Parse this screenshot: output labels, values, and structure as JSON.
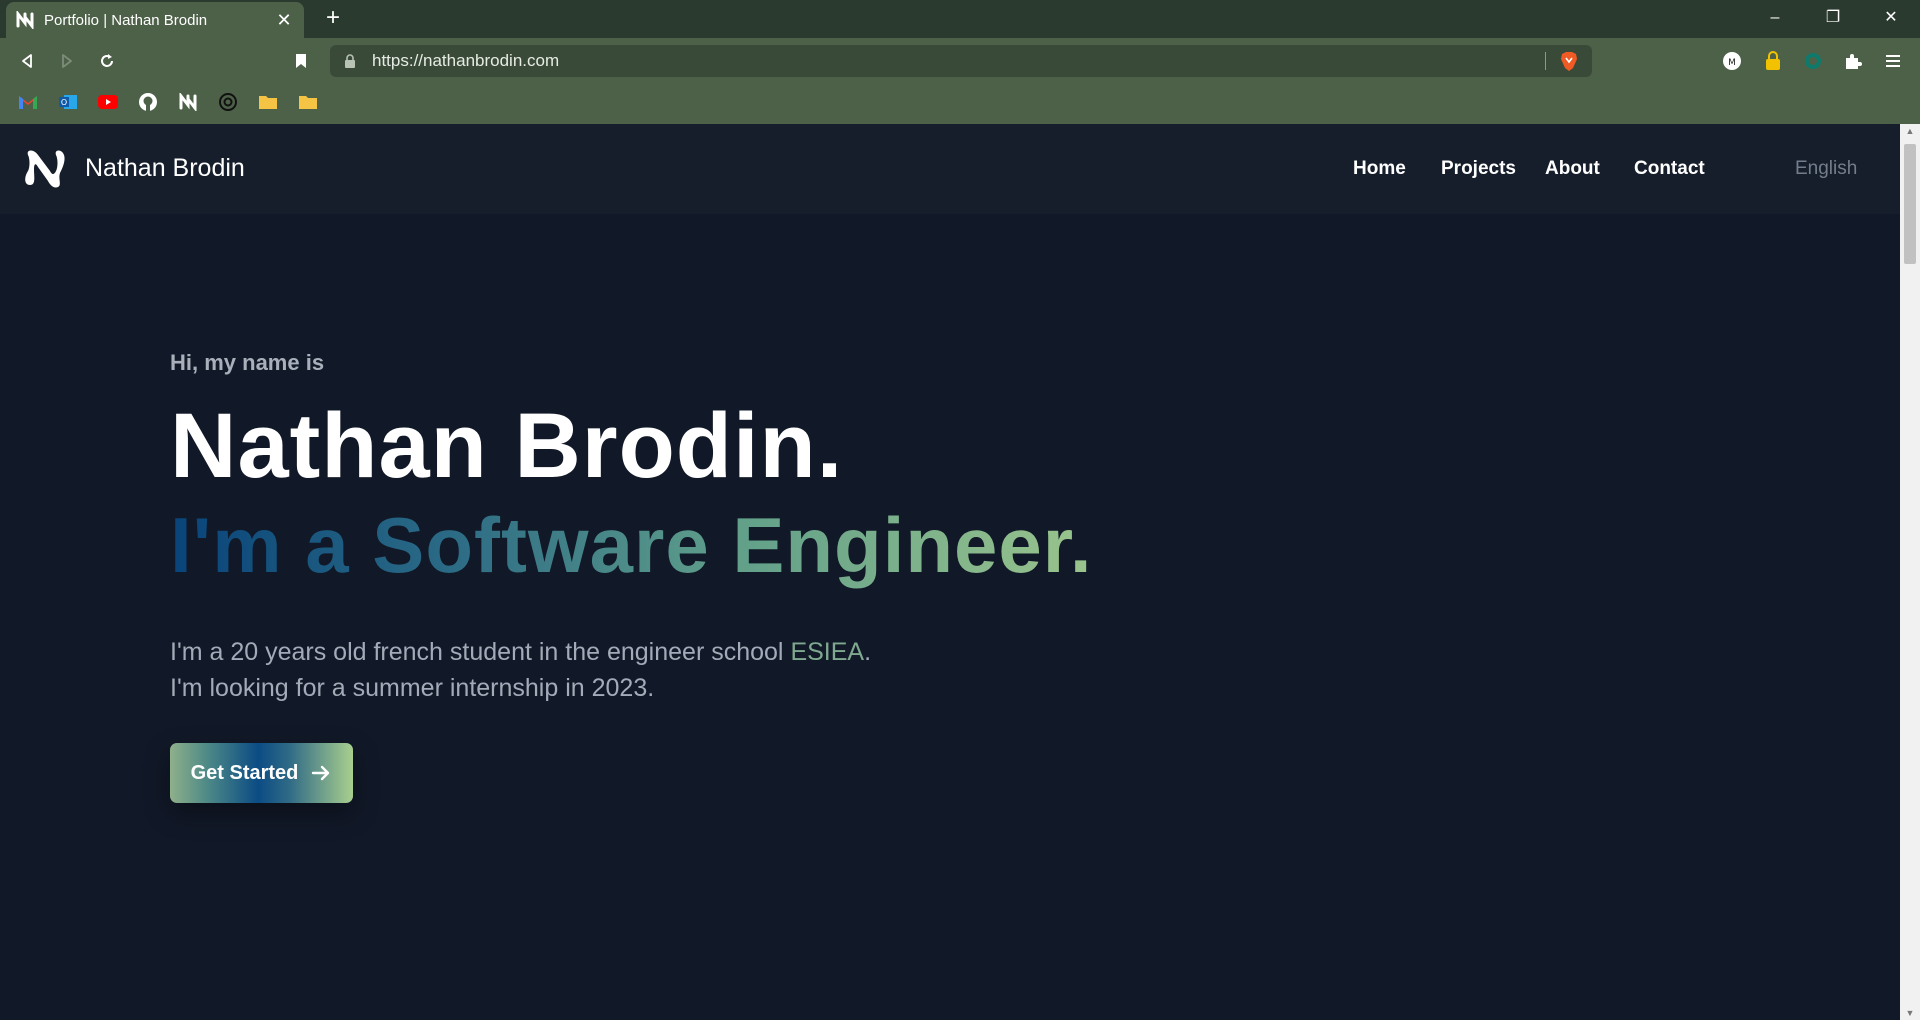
{
  "browser": {
    "tab": {
      "title": "Portfolio | Nathan Brodin",
      "favicon": "n-logo-icon"
    },
    "url": "https://nathanbrodin.com",
    "window_controls": [
      "–",
      "❐",
      "✕"
    ]
  },
  "site": {
    "brand": "Nathan Brodin",
    "nav": [
      "Home",
      "Projects",
      "About",
      "Contact"
    ],
    "language": "English"
  },
  "hero": {
    "greeting": "Hi, my name is",
    "name": "Nathan Brodin.",
    "role": "I'm a Software Engineer.",
    "intro_line1_prefix": "I'm a 20 years old french student in the engineer school ",
    "intro_school": "ESIEA",
    "intro_line1_suffix": ".",
    "intro_line2": "I'm looking for a summer internship in 2023.",
    "cta_label": "Get Started"
  },
  "colors": {
    "page_bg": "#111827",
    "navbar_bg": "#161e2c",
    "browser_frame": "#4d6048",
    "gradient_start": "#08447a",
    "gradient_end": "#9ac48c"
  }
}
